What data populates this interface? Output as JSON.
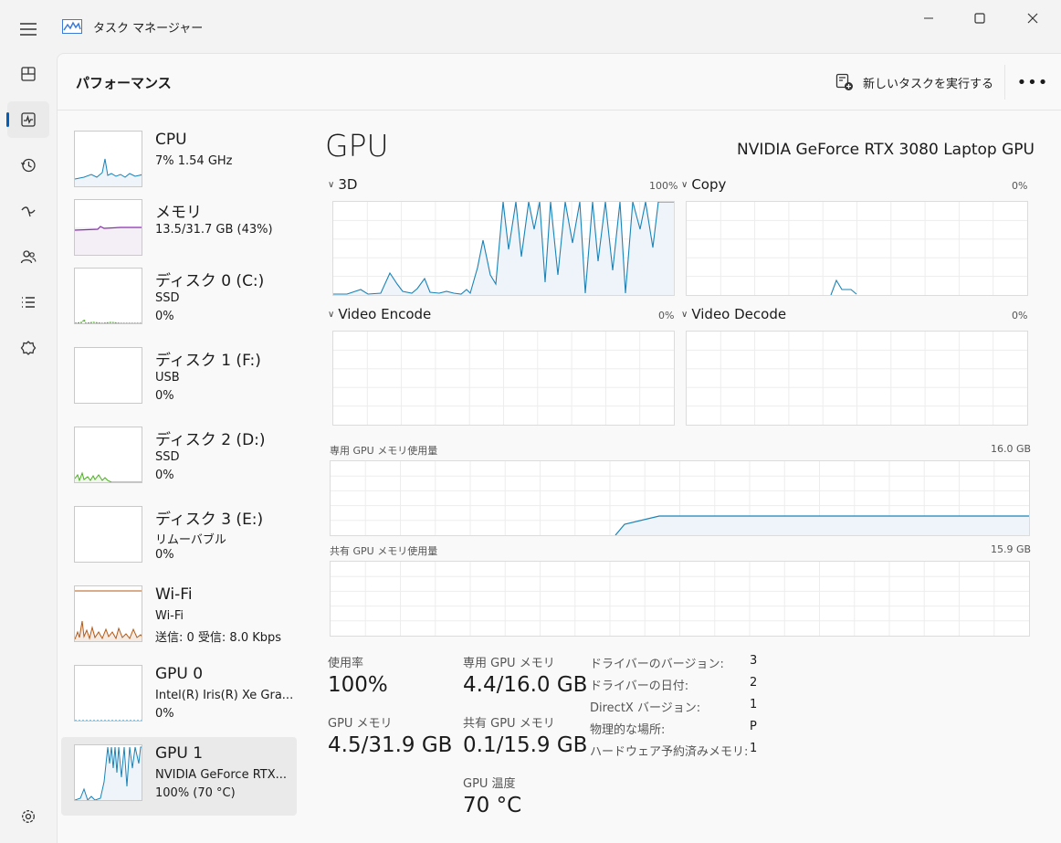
{
  "app": {
    "title": "タスク マネージャー"
  },
  "header": {
    "page_title": "パフォーマンス",
    "new_task_label": "新しいタスクを実行する",
    "more_label": "•••"
  },
  "resources": [
    {
      "name": "CPU",
      "sub1": "7%  1.54 GHz",
      "sub2": ""
    },
    {
      "name": "メモリ",
      "sub1": "13.5/31.7 GB (43%)",
      "sub2": ""
    },
    {
      "name": "ディスク 0 (C:)",
      "sub1": "SSD",
      "sub2": "0%"
    },
    {
      "name": "ディスク 1 (F:)",
      "sub1": "USB",
      "sub2": "0%"
    },
    {
      "name": "ディスク 2 (D:)",
      "sub1": "SSD",
      "sub2": "0%"
    },
    {
      "name": "ディスク 3 (E:)",
      "sub1": "リムーバブル",
      "sub2": "0%"
    },
    {
      "name": "Wi-Fi",
      "sub1": "Wi-Fi",
      "sub2": "送信: 0 受信: 8.0 Kbps"
    },
    {
      "name": "GPU 0",
      "sub1": "Intel(R) Iris(R) Xe Gra...",
      "sub2": "0%"
    },
    {
      "name": "GPU 1",
      "sub1": "NVIDIA GeForce RTX...",
      "sub2": "100%  (70 °C)"
    }
  ],
  "detail": {
    "title": "GPU",
    "model": "NVIDIA GeForce RTX 3080 Laptop GPU",
    "engines": [
      {
        "name": "3D",
        "pct": "100%"
      },
      {
        "name": "Copy",
        "pct": "0%"
      },
      {
        "name": "Video Encode",
        "pct": "0%"
      },
      {
        "name": "Video Decode",
        "pct": "0%"
      }
    ],
    "dedicated_label": "専用 GPU メモリ使用量",
    "dedicated_max": "16.0 GB",
    "shared_label": "共有 GPU メモリ使用量",
    "shared_max": "15.9 GB"
  },
  "stats": {
    "usage_label": "使用率",
    "usage_value": "100%",
    "gpu_mem_label": "GPU メモリ",
    "gpu_mem_value": "4.5/31.9 GB",
    "dedicated_label": "専用 GPU メモリ",
    "dedicated_value": "4.4/16.0 GB",
    "shared_label": "共有 GPU メモリ",
    "shared_value": "0.1/15.9 GB",
    "temp_label": "GPU 温度",
    "temp_value": "70 °C"
  },
  "info": [
    {
      "label": "ドライバーのバージョン:",
      "value": "3"
    },
    {
      "label": "ドライバーの日付:",
      "value": "2"
    },
    {
      "label": "DirectX バージョン:",
      "value": "1"
    },
    {
      "label": "物理的な場所:",
      "value": "P"
    },
    {
      "label": "ハードウェア予約済みメモリ:",
      "value": "1"
    }
  ],
  "colors": {
    "gpu_line": "#1a83b8",
    "gpu_fill": "#eef4f9",
    "mem_line": "#8b2fb0",
    "disk_line": "#4caf22",
    "wifi_line": "#b35a17",
    "accent": "#005fb8"
  }
}
